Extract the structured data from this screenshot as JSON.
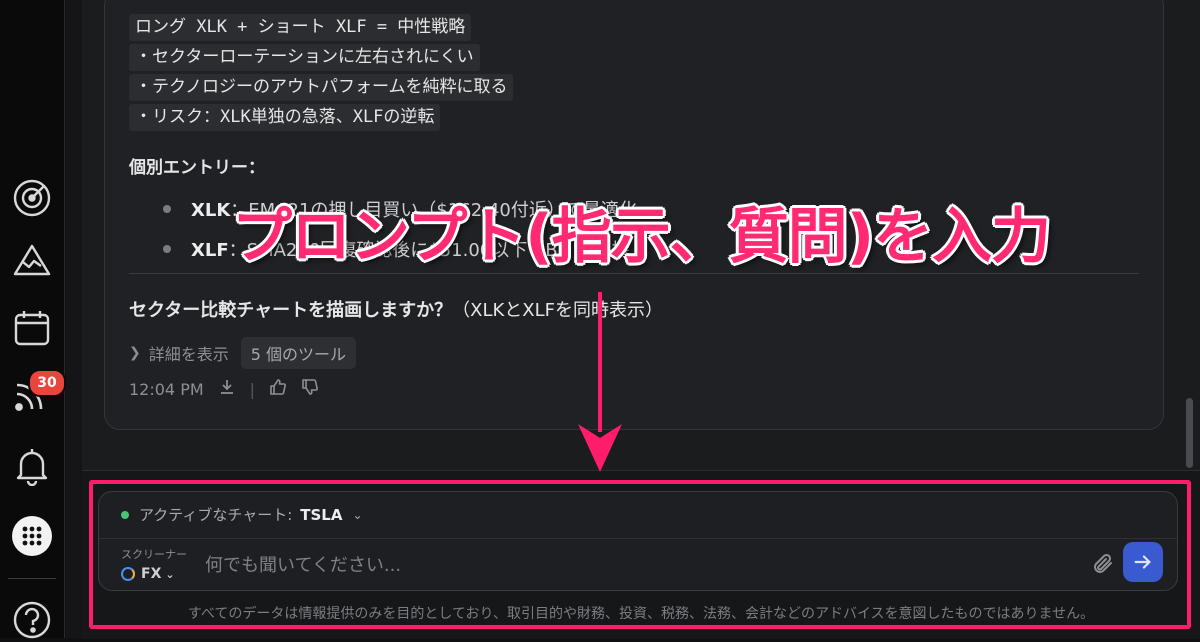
{
  "rail": {
    "badge_count": "30",
    "icons": [
      "radar-icon",
      "mountain-icon",
      "calendar-icon",
      "feed-icon",
      "bell-icon",
      "apps-grid-icon",
      "help-icon"
    ]
  },
  "message": {
    "code_lines": [
      "ロング XLK + ショート XLF = 中性戦略",
      "・セクターローテーションに左右されにくい",
      "・テクノロジーのアウトパフォームを純粋に取る",
      "・リスク：XLK単独の急落、XLFの逆転"
    ],
    "entry_heading": "個別エントリー：",
    "entries": [
      {
        "ticker": "XLK",
        "text": "：EMA21の押し目買い（$162.40付近）で最適化"
      },
      {
        "ticker": "XLF",
        "text": "：SMA200回復確認後に$51.00以下（B）で保持"
      }
    ],
    "question_bold": "セクター比較チャートを描画しますか？",
    "question_rest": "（XLKとXLFを同時表示）",
    "details_label": "詳細を表示",
    "tools_label": "5 個のツール",
    "timestamp": "12:04 PM"
  },
  "composer": {
    "active_chart_label": "アクティブなチャート:",
    "active_chart_value": "TSLA",
    "screener_label": "スクリーナー",
    "screener_value": "FX",
    "placeholder": "何でも聞いてください...",
    "disclaimer": "すべてのデータは情報提供のみを目的としており、取引目的や財務、投資、税務、法務、会計などのアドバイスを意図したものではありません。"
  },
  "annotation": {
    "text": "プロンプト(指示、質問)を入力",
    "color": "#ff2a72"
  },
  "colors": {
    "accent_send": "#3a5bd0",
    "badge": "#e8453c",
    "active_dot": "#4fc27a",
    "annotation": "#ff1c6b"
  }
}
